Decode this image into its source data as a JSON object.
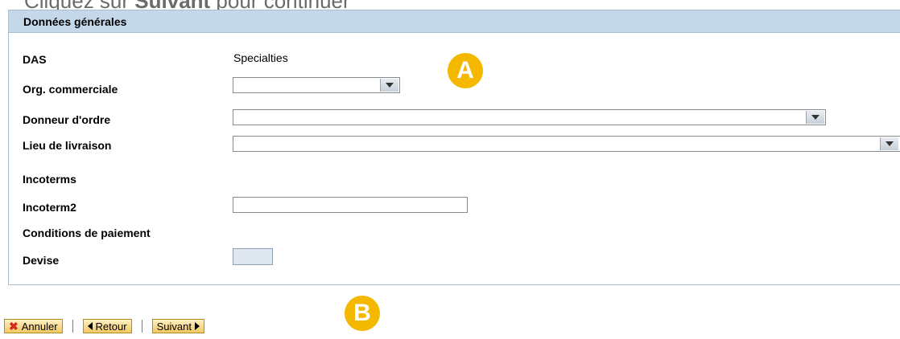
{
  "instruction": {
    "prefix": "Cliquez sur ",
    "emphasis": "Suivant",
    "suffix": " pour continuer"
  },
  "panel": {
    "title": "Données générales"
  },
  "form": {
    "das": {
      "label": "DAS",
      "value": "Specialties"
    },
    "org_commerciale": {
      "label": "Org. commerciale",
      "value": ""
    },
    "donneur_ordre": {
      "label": "Donneur d'ordre",
      "value": ""
    },
    "lieu_livraison": {
      "label": "Lieu de livraison",
      "value": ""
    },
    "incoterms": {
      "label": "Incoterms"
    },
    "incoterm2": {
      "label": "Incoterm2",
      "value": ""
    },
    "conditions_paiement": {
      "label": "Conditions de paiement"
    },
    "devise": {
      "label": "Devise",
      "value": ""
    }
  },
  "markers": {
    "a": "A",
    "b": "B"
  },
  "toolbar": {
    "annuler": "Annuler",
    "retour": "Retour",
    "suivant": "Suivant"
  },
  "colors": {
    "header_bg": "#c5d8e9",
    "marker": "#f5b800",
    "button_bg": "#f2c966"
  }
}
